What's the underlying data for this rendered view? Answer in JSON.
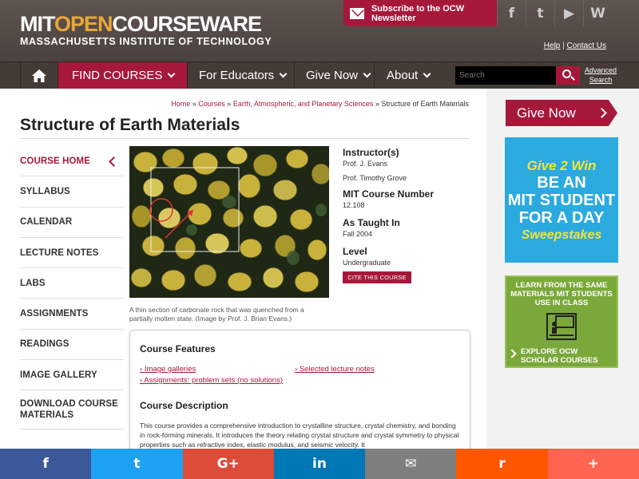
{
  "header": {
    "logo_line1_a": "MIT",
    "logo_line1_b": "OPEN",
    "logo_line1_c": "COURSEWARE",
    "logo_line2": "MASSACHUSETTS INSTITUTE OF TECHNOLOGY",
    "newsletter_label": "Subscribe to the OCW Newsletter",
    "social_icons": [
      "facebook-icon",
      "twitter-icon",
      "youtube-icon",
      "wordpress-icon"
    ],
    "social_glyphs": [
      "f",
      "t",
      "▶",
      "W"
    ],
    "help_link": "Help",
    "separator": "|",
    "contact_link": "Contact Us"
  },
  "nav": {
    "home_icon": "home-icon",
    "find_courses": "FIND COURSES",
    "for_educators": "For Educators",
    "give_now": "Give Now",
    "about": "About",
    "search_placeholder": "Search",
    "advanced_search_line1": "Advanced",
    "advanced_search_line2": "Search"
  },
  "breadcrumb": {
    "home": "Home",
    "sep": "»",
    "courses": "Courses",
    "department": "Earth, Atmospheric, and Planetary Sciences",
    "current": "Structure of Earth Materials"
  },
  "page_title": "Structure of Earth Materials",
  "sidebar": {
    "items": [
      {
        "label": "COURSE HOME",
        "active": true
      },
      {
        "label": "SYLLABUS"
      },
      {
        "label": "CALENDAR"
      },
      {
        "label": "LECTURE NOTES"
      },
      {
        "label": "LABS"
      },
      {
        "label": "ASSIGNMENTS"
      },
      {
        "label": "READINGS"
      },
      {
        "label": "IMAGE GALLERY"
      },
      {
        "label": "DOWNLOAD COURSE MATERIALS"
      }
    ]
  },
  "image": {
    "caption": "A thin section of carbonate rock that was quenched from a partially molten state. (Image by Prof. J. Brian Evans.)"
  },
  "course_info": {
    "instructors_label": "Instructor(s)",
    "instructor_1": "Prof. J. Evans",
    "instructor_2": "Prof. Timothy Grove",
    "number_label": "MIT Course Number",
    "number": "12.108",
    "taught_label": "As Taught In",
    "taught": "Fall 2004",
    "level_label": "Level",
    "level": "Undergraduate",
    "cite_button": "CITE THIS COURSE"
  },
  "features": {
    "title": "Course Features",
    "links": [
      "Image galleries",
      "Selected lecture notes",
      "Assignments: problem sets (no solutions)"
    ],
    "description_title": "Course Description",
    "description": "This course provides a comprehensive introduction to crystalline structure, crystal chemistry, and bonding in rock-forming minerals. It introduces the theory relating crystal structure and crystal symmetry to physical properties such as refractive index, elastic modulus, and seismic velocity. It"
  },
  "promos": {
    "give_now": "Give Now",
    "give2win_line1": "Give 2 Win",
    "give2win_line2": "BE AN",
    "give2win_line3": "MIT STUDENT",
    "give2win_line4": "FOR A DAY",
    "give2win_line5": "Sweepstakes",
    "scholar_top": "LEARN FROM THE SAME MATERIALS MIT STUDENTS USE IN CLASS",
    "scholar_bottom": "EXPLORE OCW SCHOLAR COURSES"
  },
  "share_bar": [
    {
      "icon": "facebook-icon",
      "glyph": "f",
      "color": "#3b5998"
    },
    {
      "icon": "twitter-icon",
      "glyph": "t",
      "color": "#1da1f2"
    },
    {
      "icon": "google-plus-icon",
      "glyph": "G+",
      "color": "#dd4b39"
    },
    {
      "icon": "linkedin-icon",
      "glyph": "in",
      "color": "#0077b5"
    },
    {
      "icon": "email-icon",
      "glyph": "✉",
      "color": "#7f7f7f"
    },
    {
      "icon": "reddit-icon",
      "glyph": "r",
      "color": "#ff5700"
    },
    {
      "icon": "more-icon",
      "glyph": "+",
      "color": "#ff6550"
    }
  ],
  "colors": {
    "brand": "#a6183a",
    "header_bg": "#4a423e",
    "accent_orange": "#e8a73a"
  }
}
